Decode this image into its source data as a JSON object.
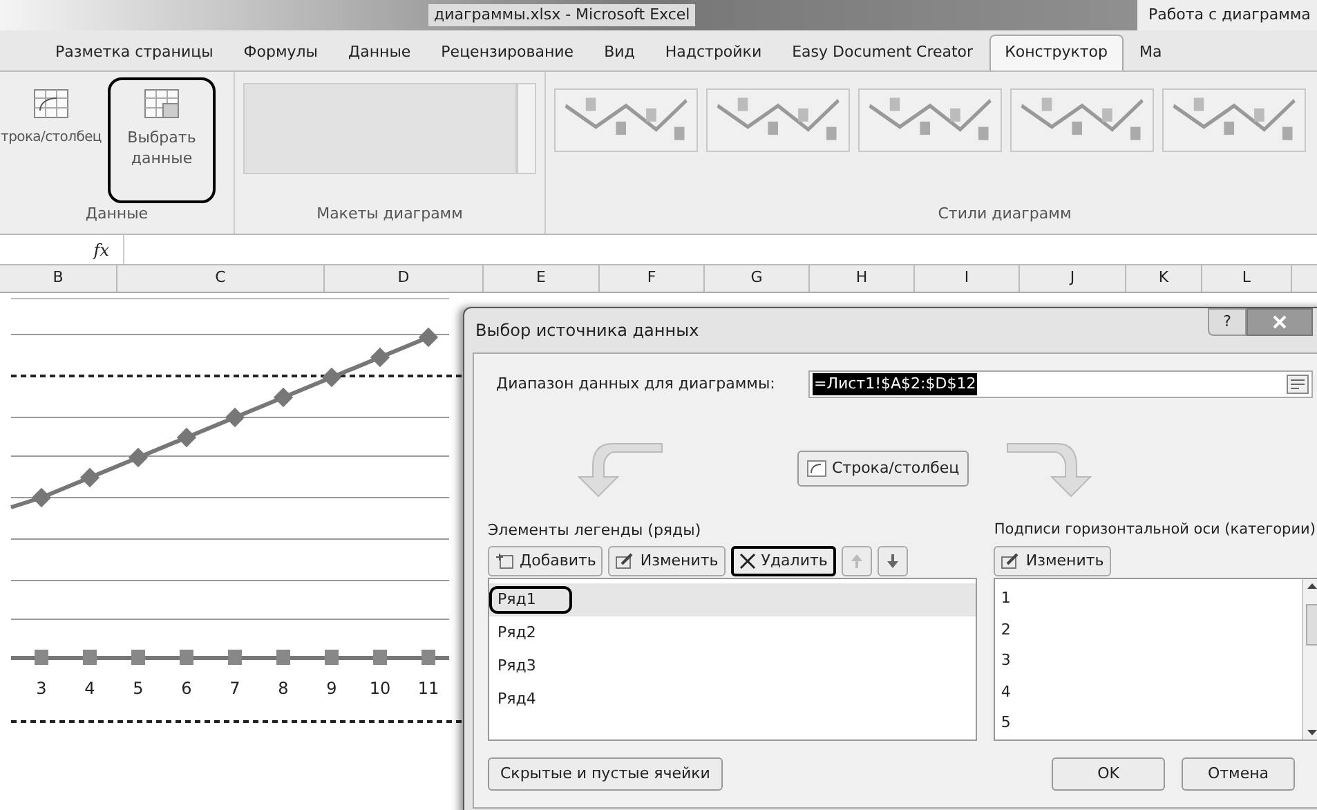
{
  "window": {
    "title": "диаграммы.xlsx - Microsoft Excel",
    "context_title": "Работа с диаграмма"
  },
  "tabs": [
    {
      "label": "Разметка страницы",
      "selected": false
    },
    {
      "label": "Формулы",
      "selected": false
    },
    {
      "label": "Данные",
      "selected": false
    },
    {
      "label": "Рецензирование",
      "selected": false
    },
    {
      "label": "Вид",
      "selected": false
    },
    {
      "label": "Надстройки",
      "selected": false
    },
    {
      "label": "Easy Document Creator",
      "selected": false
    },
    {
      "label": "Конструктор",
      "selected": true
    },
    {
      "label": "Ма",
      "selected": false
    }
  ],
  "ribbon": {
    "buttons": [
      {
        "label": "трока/столбец",
        "highlighted": false
      },
      {
        "label": "Выбрать данные",
        "highlighted": true
      }
    ],
    "groups": [
      "Данные",
      "Макеты диаграмм",
      "Стили диаграмм"
    ]
  },
  "formula_bar": {
    "fx": "fx"
  },
  "columns": [
    "B",
    "C",
    "D",
    "E",
    "F",
    "G",
    "H",
    "I",
    "J",
    "K",
    "L"
  ],
  "chart": {
    "x_labels": [
      "3",
      "4",
      "5",
      "6",
      "7",
      "8",
      "9",
      "10",
      "11"
    ]
  },
  "dialog": {
    "title": "Выбор источника данных",
    "help": "?",
    "range_label": "Диапазон данных для диаграммы:",
    "range_value": "=Лист1!$A$2:$D$12",
    "switch_button": "Строка/столбец",
    "legend": {
      "title": "Элементы легенды (ряды)",
      "buttons": [
        {
          "label": "Добавить",
          "kind": "add",
          "highlighted": false
        },
        {
          "label": "Изменить",
          "kind": "edit",
          "highlighted": false
        },
        {
          "label": "Удалить",
          "kind": "delete",
          "highlighted": true
        },
        {
          "kind": "up",
          "highlighted": false
        },
        {
          "kind": "down",
          "highlighted": false
        }
      ],
      "items": [
        {
          "label": "Ряд1",
          "selected": true,
          "highlighted": true
        },
        {
          "label": "Ряд2",
          "selected": false,
          "highlighted": false
        },
        {
          "label": "Ряд3",
          "selected": false,
          "highlighted": false
        },
        {
          "label": "Ряд4",
          "selected": false,
          "highlighted": false
        }
      ]
    },
    "axis": {
      "title": "Подписи горизонтальной оси (категории)",
      "button": "Изменить",
      "items": [
        "1",
        "2",
        "3",
        "4",
        "5"
      ]
    },
    "hidden_cells_button": "Скрытые и пустые ячейки",
    "ok": "OK",
    "cancel": "Отмена"
  }
}
